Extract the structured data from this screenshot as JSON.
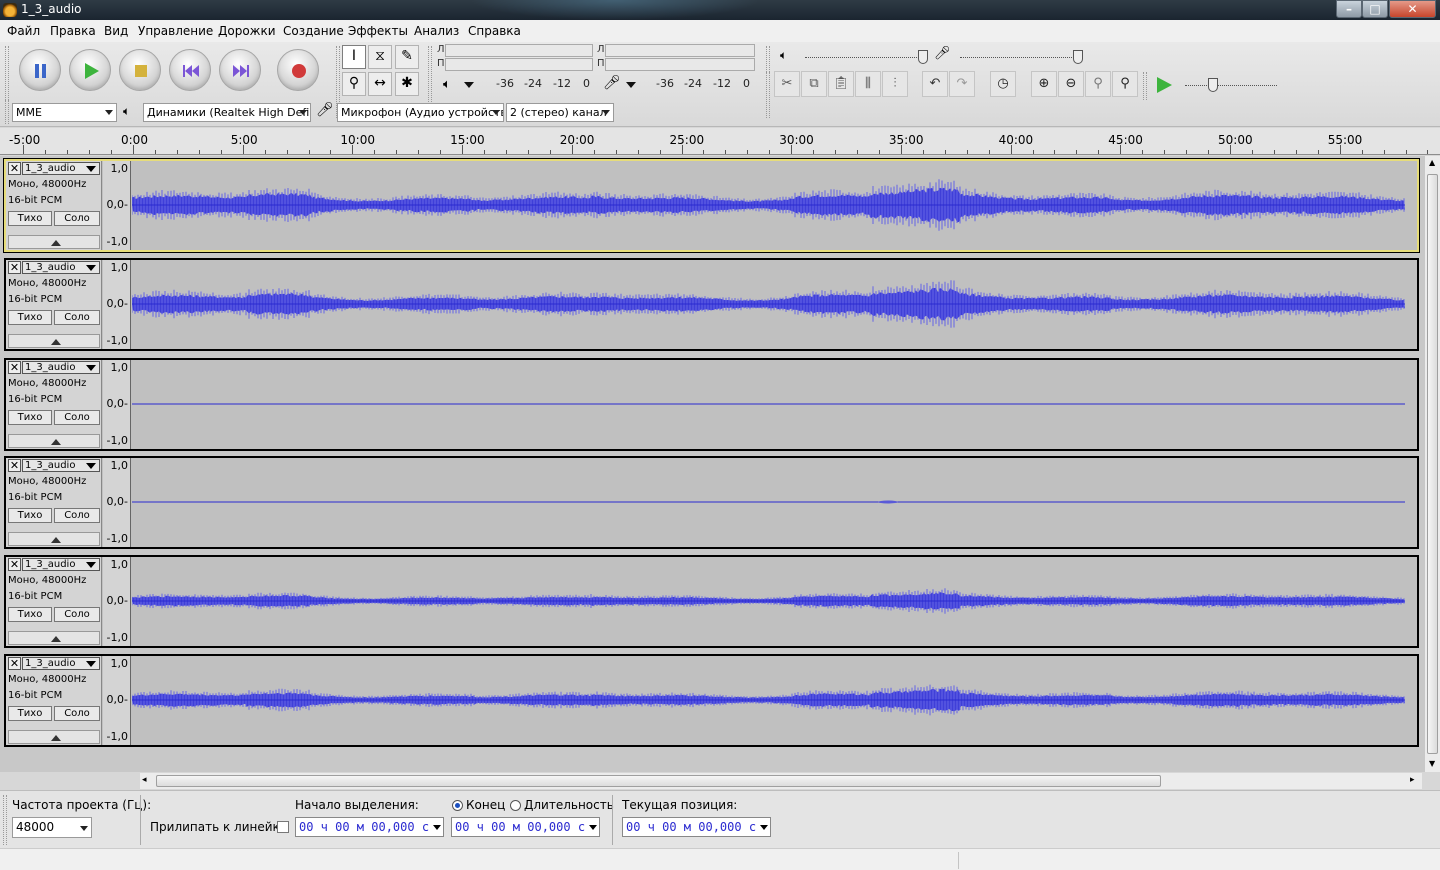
{
  "window": {
    "title": "1_3_audio"
  },
  "menu": [
    "Файл",
    "Правка",
    "Вид",
    "Управление",
    "Дорожки",
    "Создание",
    "Эффекты",
    "Анализ",
    "Справка"
  ],
  "meters": {
    "left_letter": "Л",
    "right_letter": "П",
    "ticks": [
      "-36",
      "-24",
      "-12",
      "0"
    ]
  },
  "device": {
    "host": "MME",
    "playback": "Динамики (Realtek High Defin",
    "recording": "Микрофон (Аудио устройств",
    "channels": "2 (стерео) канал"
  },
  "ruler": {
    "labels": [
      "-5:00",
      "0:00",
      "5:00",
      "10:00",
      "15:00",
      "20:00",
      "25:00",
      "30:00",
      "35:00",
      "40:00",
      "45:00",
      "50:00",
      "55:00"
    ]
  },
  "tracks": [
    {
      "name": "1_3_audio",
      "info1": "Моно, 48000Hz",
      "info2": "16-bit PCM",
      "mute": "Тихо",
      "solo": "Соло",
      "scale_top": "1,0",
      "scale_mid": "0,0-",
      "scale_bot": "-1,0",
      "amplitude": 0.6,
      "selected": true
    },
    {
      "name": "1_3_audio",
      "info1": "Моно, 48000Hz",
      "info2": "16-bit PCM",
      "mute": "Тихо",
      "solo": "Соло",
      "scale_top": "1,0",
      "scale_mid": "0,0-",
      "scale_bot": "-1,0",
      "amplitude": 0.55,
      "selected": false
    },
    {
      "name": "1_3_audio",
      "info1": "Моно, 48000Hz",
      "info2": "16-bit PCM",
      "mute": "Тихо",
      "solo": "Соло",
      "scale_top": "1,0",
      "scale_mid": "0,0-",
      "scale_bot": "-1,0",
      "amplitude": 0.0,
      "selected": false
    },
    {
      "name": "1_3_audio",
      "info1": "Моно, 48000Hz",
      "info2": "16-bit PCM",
      "mute": "Тихо",
      "solo": "Соло",
      "scale_top": "1,0",
      "scale_mid": "0,0-",
      "scale_bot": "-1,0",
      "amplitude": 0.02,
      "selected": false
    },
    {
      "name": "1_3_audio",
      "info1": "Моно, 48000Hz",
      "info2": "16-bit PCM",
      "mute": "Тихо",
      "solo": "Соло",
      "scale_top": "1,0",
      "scale_mid": "0,0-",
      "scale_bot": "-1,0",
      "amplitude": 0.3,
      "selected": false
    },
    {
      "name": "1_3_audio",
      "info1": "Моно, 48000Hz",
      "info2": "16-bit PCM",
      "mute": "Тихо",
      "solo": "Соло",
      "scale_top": "1,0",
      "scale_mid": "0,0-",
      "scale_bot": "-1,0",
      "amplitude": 0.38,
      "selected": false
    }
  ],
  "selection": {
    "project_rate_label": "Частота проекта (Гц):",
    "project_rate": "48000",
    "snap_label": "Прилипать к линейке",
    "sel_start_label": "Начало выделения:",
    "end_label": "Конец",
    "length_label": "Длительность",
    "position_label": "Текущая позиция:",
    "start_value": "00 ч 00 м 00,000 с",
    "end_value": "00 ч 00 м 00,000 с",
    "position_value": "00 ч 00 м 00,000 с"
  },
  "colors": {
    "wave": "#3f3fd8",
    "wave_light": "#6464e6",
    "track_bg": "#c0c0c0",
    "selected_border": "#e6dc7a"
  }
}
